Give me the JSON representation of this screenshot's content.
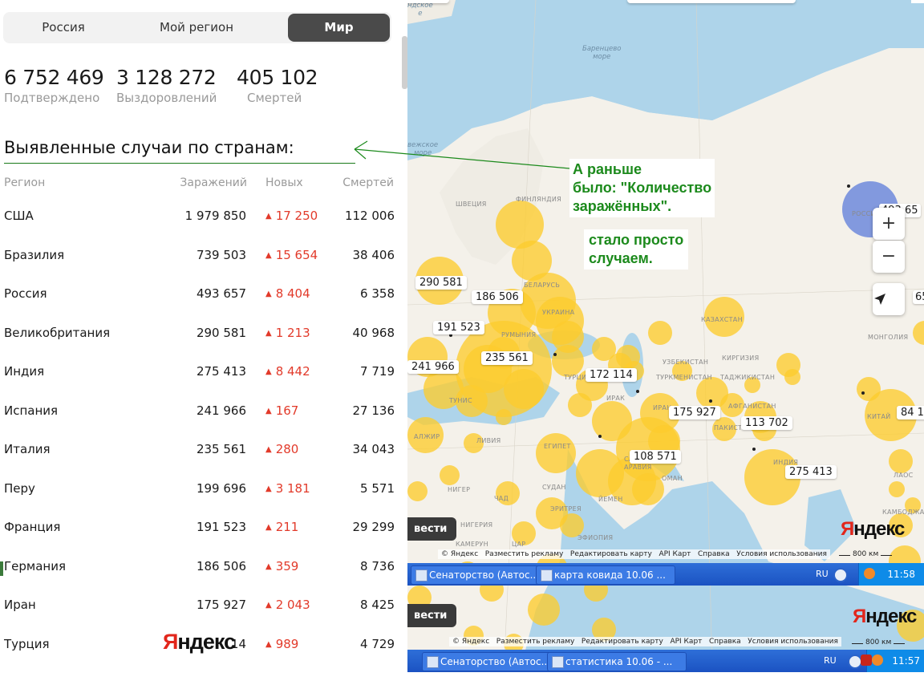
{
  "tabs": [
    {
      "label": "Россия",
      "active": false
    },
    {
      "label": "Мой регион",
      "active": false
    },
    {
      "label": "Мир",
      "active": true
    }
  ],
  "stats": [
    {
      "value": "6 752 469",
      "label": "Подтверждено"
    },
    {
      "value": "3 128 272",
      "label": "Выздоровлений"
    },
    {
      "value": "405 102",
      "label": "Смертей"
    }
  ],
  "heading": "Выявленные случаи по странам:",
  "table": {
    "headers": {
      "region": "Регион",
      "infections": "Заражений",
      "new": "Новых",
      "deaths": "Смертей"
    },
    "rows": [
      {
        "name": "США",
        "infections": "1 979 850",
        "new": "17 250",
        "deaths": "112 006"
      },
      {
        "name": "Бразилия",
        "infections": "739 503",
        "new": "15 654",
        "deaths": "38 406"
      },
      {
        "name": "Россия",
        "infections": "493 657",
        "new": "8 404",
        "deaths": "6 358"
      },
      {
        "name": "Великобритания",
        "infections": "290 581",
        "new": "1 213",
        "deaths": "40 968"
      },
      {
        "name": "Индия",
        "infections": "275 413",
        "new": "8 442",
        "deaths": "7 719"
      },
      {
        "name": "Испания",
        "infections": "241 966",
        "new": "167",
        "deaths": "27 136"
      },
      {
        "name": "Италия",
        "infections": "235 561",
        "new": "280",
        "deaths": "34 043"
      },
      {
        "name": "Перу",
        "infections": "199 696",
        "new": "3 181",
        "deaths": "5 571"
      },
      {
        "name": "Франция",
        "infections": "191 523",
        "new": "211",
        "deaths": "29 299"
      },
      {
        "name": "Германия",
        "infections": "186 506",
        "new": "359",
        "deaths": "8 736"
      },
      {
        "name": "Иран",
        "infections": "175 927",
        "new": "2 043",
        "deaths": "8 425"
      },
      {
        "name": "Турция",
        "infections": "14",
        "new": "989",
        "deaths": "4 729"
      }
    ]
  },
  "yandex_logo": {
    "red": "Я",
    "black": "ндекс"
  },
  "map": {
    "labels": [
      "290 581",
      "186 506",
      "191 523",
      "235 561",
      "241 966",
      "172 114",
      "175 927",
      "113 702",
      "108 571",
      "275 413",
      "84 1",
      "493 65",
      "65"
    ],
    "places": [
      "ФИНЛЯНДИЯ",
      "ШВЕЦИЯ",
      "БЕЛАРУСЬ",
      "УКРАИНА",
      "РУМЫНИЯ",
      "КАЗАХСТАН",
      "МОНГОЛИЯ",
      "УЗБЕКИСТАН",
      "КИРГИЗИЯ",
      "ТУРКМЕНИСТАН",
      "ТАДЖИКИСТАН",
      "ТУРЦИЯ",
      "ИРАК",
      "ИРАН",
      "АФГАНИСТАН",
      "ПАКИСТАН",
      "КИТАЙ",
      "ИНДИЯ",
      "САУДОВСКАЯ",
      "АРАВИЯ",
      "ОМАН",
      "ЕГИПЕТ",
      "ЛИВИЯ",
      "АЛЖИР",
      "ТУНИС",
      "СУДАН",
      "ЧАД",
      "НИГЕР",
      "НИГЕРИЯ",
      "ЭРИТРЕЯ",
      "ЙЕМЕН",
      "ЭФИОПИЯ",
      "КАМЕРУН",
      "ЦАР",
      "ЛАОС",
      "КАМБОДЖА",
      "РОССИЯ"
    ],
    "seas": {
      "barents": "Баренцево\nморе",
      "norwegian": "вежское\nморе",
      "greenland": "ндское\nе"
    },
    "controls": {
      "zoom_in": "+",
      "zoom_out": "−"
    },
    "copyright": [
      "© Яндекс",
      "Разместить рекламу",
      "Редактировать карту",
      "API Карт",
      "Справка",
      "Условия использования"
    ],
    "scale": "800 км",
    "pill": "вести",
    "pill_2": "вести"
  },
  "taskbar_1": {
    "items": [
      "Сенаторство (Автос...",
      "карта ковида 10.06 ..."
    ],
    "lang": "RU",
    "time": "11:58"
  },
  "taskbar_2": {
    "items": [
      "Сенаторство (Автос...",
      "статистика 10.06 - ..."
    ],
    "lang": "RU",
    "time": "11:57"
  },
  "annotation": {
    "line1": "А раньше",
    "line2": "было: \"Количество",
    "line3": "заражённых\".",
    "line4": "стало просто",
    "line5": "случаем."
  },
  "colors": {
    "bubble": "#fdcc2d",
    "new_cases": "#e23a2a",
    "annotation": "#1c8a1c",
    "russia_bubble": "#7b93dd"
  }
}
